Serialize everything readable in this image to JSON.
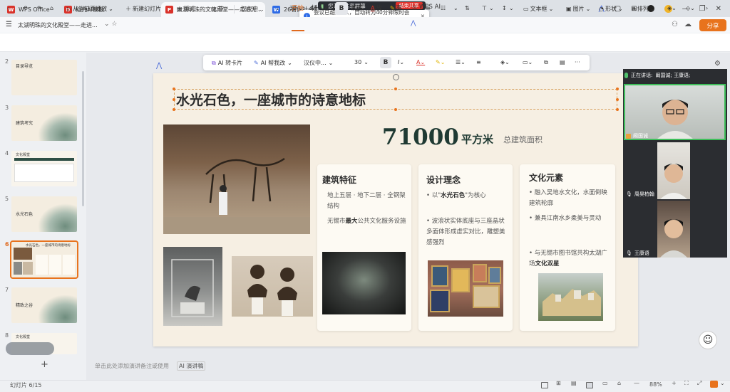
{
  "tabs": [
    {
      "label": "WPS Office",
      "icon": "wps-logo-icon",
      "color": "#d9322a"
    },
    {
      "label": "稻壳AI模板",
      "icon": "docer-icon",
      "color": "#d9322a"
    },
    {
      "label": "太湖明珠的文化殿堂——走进无...",
      "icon": "ppt-file-icon",
      "color": "#d9322a"
    },
    {
      "label": "26暑假社会实践...",
      "icon": "word-file-icon",
      "color": "#2e6be6"
    }
  ],
  "share_bar": {
    "status": "您正在共享屏幕",
    "stop_label": "结束共享"
  },
  "toast": {
    "text": "会议已超过2人，自动转为40分钟限时会议。"
  },
  "doc": {
    "title": "太湖明珠的文化殿堂——走进..."
  },
  "menu": {
    "items": [
      "开始",
      "插入",
      "审阅",
      "视图",
      "播放",
      "效率",
      "WPS AI"
    ],
    "active": "开始",
    "share_label": "分享"
  },
  "ribbon": {
    "from_current": "从当前页播放",
    "new_slide": "新建幻灯片",
    "layout": "版式",
    "section": "节",
    "font_name": "汉仪中...",
    "font_size": "30",
    "textbox": "文本框",
    "picture": "图片",
    "shape": "形状",
    "arrange": "排列"
  },
  "float_toolbar": {
    "ai_card": "AI 转卡片",
    "ai_help": "AI 帮我改",
    "font_name": "汉仪中...",
    "font_size": "30"
  },
  "thumbnails": [
    {
      "num": "2",
      "title": "目录导览"
    },
    {
      "num": "3",
      "title": "建筑考究"
    },
    {
      "num": "4",
      "title": "文化殿堂"
    },
    {
      "num": "5",
      "title": "水光石色"
    },
    {
      "num": "6",
      "title": "水光石色，一座城市的诗意地标"
    },
    {
      "num": "7",
      "title": "精致之谷"
    },
    {
      "num": "8",
      "title": "文化殿堂"
    }
  ],
  "slide": {
    "title": "水光石色，一座城市的诗意地标",
    "stat_value": "71000",
    "stat_unit": "平方米",
    "stat_desc": "总建筑面积",
    "cards": [
      {
        "title": "建筑特征",
        "p1": "地上五层 · 地下二层 · 全钢架结构",
        "p2_pre": "无锡市",
        "p2_bold": "最大",
        "p2_post": "公共文化服务设施"
      },
      {
        "title": "设计理念",
        "p1_pre": "以\"",
        "p1_bold": "水光石色",
        "p1_post": "\"为核心",
        "p2": "波浪状实体底座与三座晶状多面体形成虚实对比，雕塑美感强烈"
      },
      {
        "title": "文化元素",
        "p1": "融入吴地水文化，水面倒映建筑轮廓",
        "p2": "兼具江南水乡柔美与灵动",
        "p3_pre": "与无锡市图书馆共构太湖广场",
        "p3_bold": "文化双星"
      }
    ]
  },
  "video": {
    "speaking_label": "正在讲话:",
    "speaking_names": "阚国诚; 王康语;",
    "participants": [
      "阚国诚",
      "周昊柏翰",
      "王康语"
    ]
  },
  "notes_placeholder": "单击此处添加演讲备注或使用",
  "notes_ai": "AI 演讲稿",
  "status": {
    "slide_counter": "幻灯片 6/15",
    "zoom": "88%"
  },
  "colors": {
    "accent": "#e8731d",
    "title_dark": "#1f3a33"
  }
}
